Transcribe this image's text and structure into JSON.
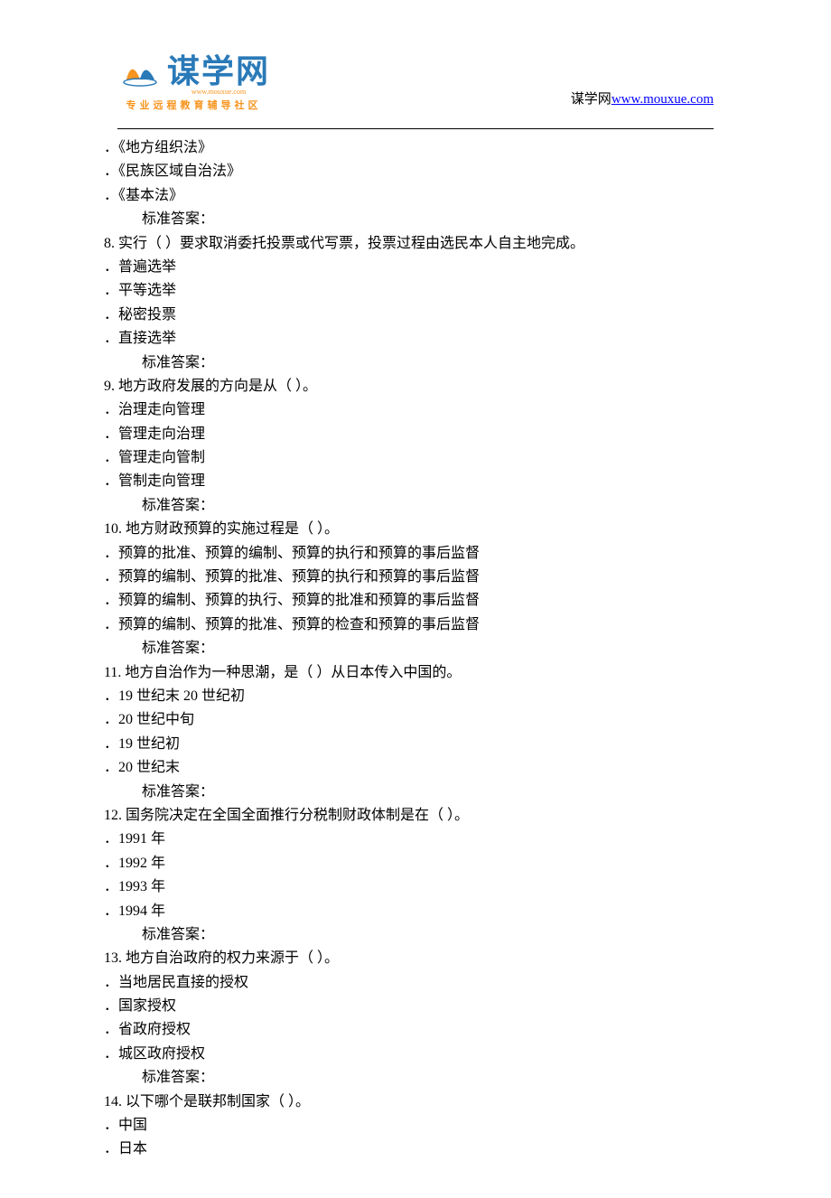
{
  "header": {
    "logo_main": "谋学网",
    "logo_url": "www.mouxue.com",
    "logo_subtitle": "专业远程教育辅导社区",
    "site_label": "谋学网",
    "site_url": "www.mouxue.com"
  },
  "content": {
    "pre_options": [
      "．《地方组织法》",
      "．《民族区域自治法》",
      "．《基本法》"
    ],
    "pre_answer": "标准答案：",
    "questions": [
      {
        "q": "8.  实行（  ）要求取消委托投票或代写票，投票过程由选民本人自主地完成。",
        "opts": [
          "．普遍选举",
          "．平等选举",
          "．秘密投票",
          "．直接选举"
        ],
        "ans": "标准答案："
      },
      {
        "q": "9.  地方政府发展的方向是从（  ）。",
        "opts": [
          "．治理走向管理",
          "．管理走向治理",
          "．管理走向管制",
          "．管制走向管理"
        ],
        "ans": "标准答案："
      },
      {
        "q": "10.  地方财政预算的实施过程是（  ）。",
        "opts": [
          "．预算的批准、预算的编制、预算的执行和预算的事后监督",
          "．预算的编制、预算的批准、预算的执行和预算的事后监督",
          "．预算的编制、预算的执行、预算的批准和预算的事后监督",
          "．预算的编制、预算的批准、预算的检查和预算的事后监督"
        ],
        "ans": "标准答案："
      },
      {
        "q": "11.  地方自治作为一种思潮，是（  ）从日本传入中国的。",
        "opts": [
          "．19 世纪末 20 世纪初",
          "．20 世纪中旬",
          "．19 世纪初",
          "．20 世纪末"
        ],
        "ans": "标准答案："
      },
      {
        "q": "12.  国务院决定在全国全面推行分税制财政体制是在（  ）。",
        "opts": [
          "．1991 年",
          "．1992 年",
          "．1993 年",
          "．1994 年"
        ],
        "ans": "标准答案："
      },
      {
        "q": "13.  地方自治政府的权力来源于（  ）。",
        "opts": [
          "．当地居民直接的授权",
          "．国家授权",
          "．省政府授权",
          "．城区政府授权"
        ],
        "ans": "标准答案："
      },
      {
        "q": "14.  以下哪个是联邦制国家（  ）。",
        "opts": [
          "．中国",
          "．日本"
        ],
        "ans": null
      }
    ]
  }
}
